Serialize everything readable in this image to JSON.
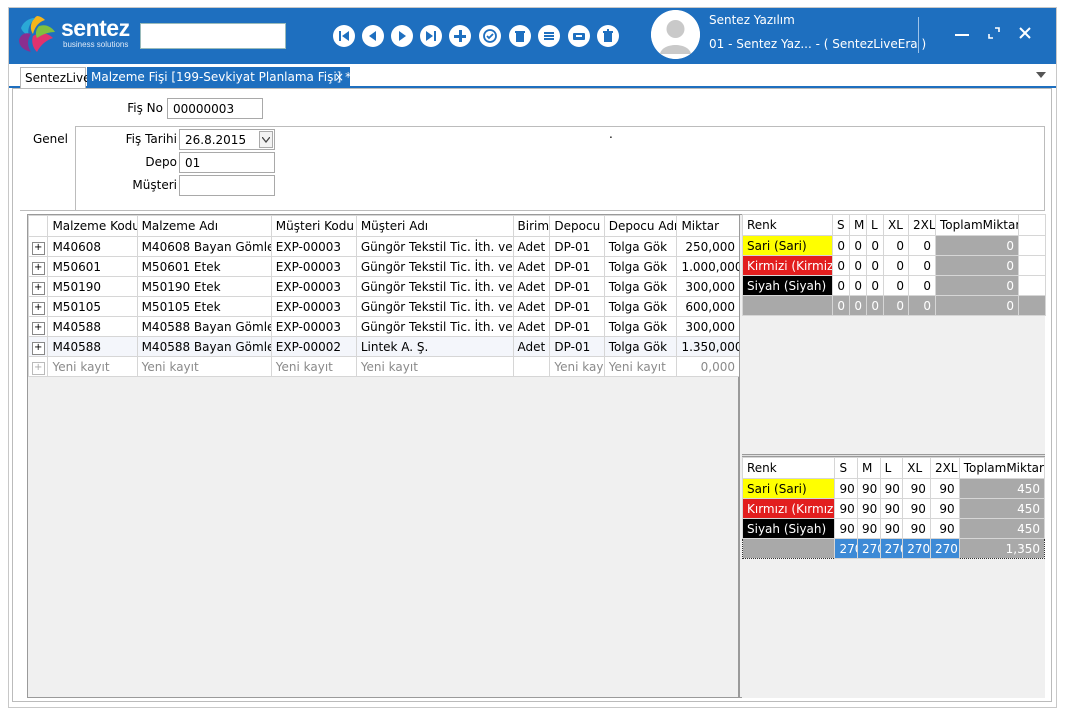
{
  "titlebar": {
    "brand": "sentez",
    "brand_sub": "business solutions",
    "search_value": "",
    "user_name": "Sentez Yazılım",
    "user_company": "01 - Sentez Yaz... - ( SentezLiveEra )",
    "toolbar_icons": [
      "first-icon",
      "previous-icon",
      "next-icon",
      "last-icon",
      "add-icon",
      "approve-icon",
      "delete-icon",
      "list-icon",
      "print-icon",
      "trash-icon"
    ],
    "accent": "#1e6fbf"
  },
  "tabs": [
    {
      "label": "SentezLive"
    },
    {
      "label": "Malzeme Fişi  [199-Sevkiyat Planlama Fişi] *",
      "close": "×"
    }
  ],
  "header": {
    "fis_no_label": "Fiş No",
    "fis_no": "00000003",
    "genel_label": "Genel",
    "fis_tarihi_label": "Fiş Tarihi",
    "fis_tarihi": "26.8.2015",
    "depo_label": "Depo",
    "depo": "01",
    "musteri_label": "Müşteri",
    "musteri": "",
    "dot": "."
  },
  "main_grid": {
    "columns": [
      "Malzeme Kodu",
      "Malzeme Adı",
      "Müşteri Kodu",
      "Müşteri Adı",
      "Birim",
      "Depocu",
      "Depocu Adı",
      "Miktar"
    ],
    "rows": [
      [
        "M40608",
        "M40608 Bayan Gömlek",
        "EXP-00003",
        "Güngör Tekstil Tic. İth. ve İh",
        "Adet",
        "DP-01",
        "Tolga Gök",
        "250,000"
      ],
      [
        "M50601",
        "M50601 Etek",
        "EXP-00003",
        "Güngör Tekstil Tic. İth. ve İh",
        "Adet",
        "DP-01",
        "Tolga Gök",
        "1.000,000"
      ],
      [
        "M50190",
        "M50190 Etek",
        "EXP-00003",
        "Güngör Tekstil Tic. İth. ve İh",
        "Adet",
        "DP-01",
        "Tolga Gök",
        "300,000"
      ],
      [
        "M50105",
        "M50105 Etek",
        "EXP-00003",
        "Güngör Tekstil Tic. İth. ve İh",
        "Adet",
        "DP-01",
        "Tolga Gök",
        "600,000"
      ],
      [
        "M40588",
        "M40588 Bayan Gömlek",
        "EXP-00003",
        "Güngör Tekstil Tic. İth. ve İh",
        "Adet",
        "DP-01",
        "Tolga Gök",
        "300,000"
      ],
      [
        "M40588",
        "M40588 Bayan Gömlek",
        "EXP-00002",
        "Lintek A. Ş.",
        "Adet",
        "DP-01",
        "Tolga Gök",
        "1.350,000"
      ]
    ],
    "new_row": [
      "Yeni kayıt",
      "Yeni kayıt",
      "Yeni kayıt",
      "Yeni kayıt",
      "",
      "Yeni kayıt",
      "Yeni kayıt",
      "0,000"
    ],
    "expand_symbol": "+"
  },
  "size_grid_top": {
    "columns": [
      "Renk",
      "S",
      "M",
      "L",
      "XL",
      "2XL",
      "ToplamMiktar"
    ],
    "rows": [
      {
        "renk": "Sari (Sari)",
        "vals": [
          "0",
          "0",
          "0",
          "0",
          "0"
        ],
        "total": "0",
        "color": "#ffff00"
      },
      {
        "renk": "Kirmizi (Kirmizi)",
        "vals": [
          "0",
          "0",
          "0",
          "0",
          "0"
        ],
        "total": "0",
        "color": "#e21e1e"
      },
      {
        "renk": "Siyah (Siyah)",
        "vals": [
          "0",
          "0",
          "0",
          "0",
          "0"
        ],
        "total": "0",
        "color": "#000000"
      }
    ],
    "sum": [
      "0",
      "0",
      "0",
      "0",
      "0",
      "0"
    ]
  },
  "size_grid_bottom": {
    "columns": [
      "Renk",
      "S",
      "M",
      "L",
      "XL",
      "2XL",
      "ToplamMiktar"
    ],
    "rows": [
      {
        "renk": "Sari (Sari)",
        "vals": [
          "90",
          "90",
          "90",
          "90",
          "90"
        ],
        "total": "450",
        "color": "#ffff00"
      },
      {
        "renk": "Kırmızı (Kırmızı)",
        "vals": [
          "90",
          "90",
          "90",
          "90",
          "90"
        ],
        "total": "450",
        "color": "#e21e1e"
      },
      {
        "renk": "Siyah (Siyah)",
        "vals": [
          "90",
          "90",
          "90",
          "90",
          "90"
        ],
        "total": "450",
        "color": "#000000"
      }
    ],
    "sum": [
      "270",
      "270",
      "270",
      "270",
      "270",
      "1,350"
    ]
  }
}
